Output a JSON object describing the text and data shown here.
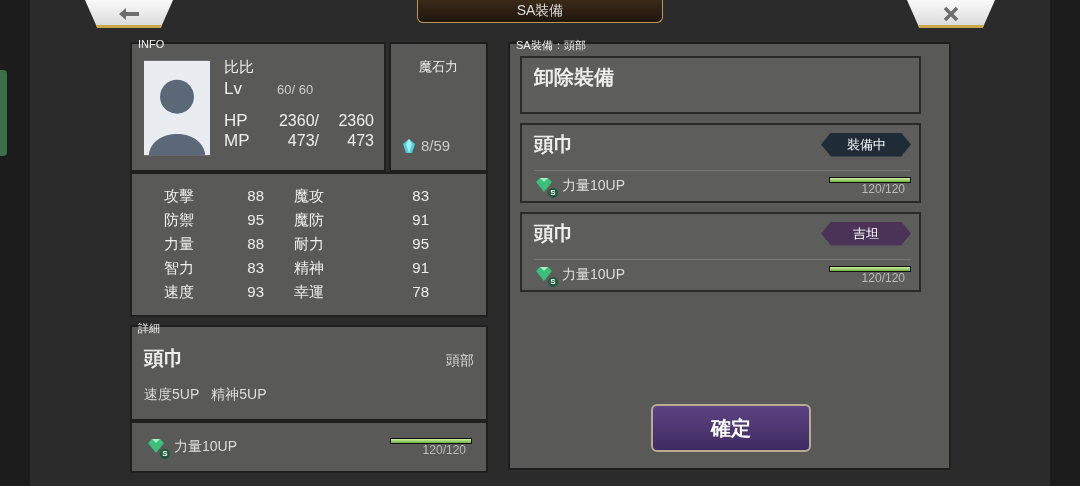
{
  "top_bar": {
    "title": "SA裝備"
  },
  "info": {
    "label": "INFO",
    "character": {
      "name": "比比",
      "lv_label": "Lv",
      "level_text": "60/ 60",
      "hp_label": "HP",
      "hp_current": "2360/",
      "hp_max": "2360",
      "mp_label": "MP",
      "mp_current": "473/",
      "mp_max": "473"
    },
    "magicite": {
      "title": "魔石力",
      "value": "8/59"
    }
  },
  "stats": [
    {
      "label": "攻擊",
      "value": "88"
    },
    {
      "label": "魔攻",
      "value": "83"
    },
    {
      "label": "防禦",
      "value": "95"
    },
    {
      "label": "魔防",
      "value": "91"
    },
    {
      "label": "力量",
      "value": "88"
    },
    {
      "label": "耐力",
      "value": "95"
    },
    {
      "label": "智力",
      "value": "83"
    },
    {
      "label": "精神",
      "value": "91"
    },
    {
      "label": "速度",
      "value": "93"
    },
    {
      "label": "幸運",
      "value": "78"
    }
  ],
  "detail": {
    "label": "詳細",
    "name": "頭巾",
    "slot": "頭部",
    "effects": [
      "速度5UP",
      "精神5UP"
    ],
    "ability": {
      "badge": "S",
      "text": "力量10UP",
      "level": 1.0,
      "reading": "120/120"
    }
  },
  "equipment_list": {
    "label": "SA裝備：頭部",
    "unequip": "卸除裝備",
    "items": [
      {
        "name": "頭巾",
        "tag": "裝備中",
        "color": "#1f2c38",
        "ability": {
          "badge": "S",
          "text": "力量10UP",
          "level": 1.0,
          "reading": "120/120"
        }
      },
      {
        "name": "頭巾",
        "tag": "吉坦",
        "color": "#4b3358",
        "ability": {
          "badge": "S",
          "text": "力量10UP",
          "level": 1.0,
          "reading": "120/120"
        }
      }
    ],
    "confirm": "確定"
  }
}
